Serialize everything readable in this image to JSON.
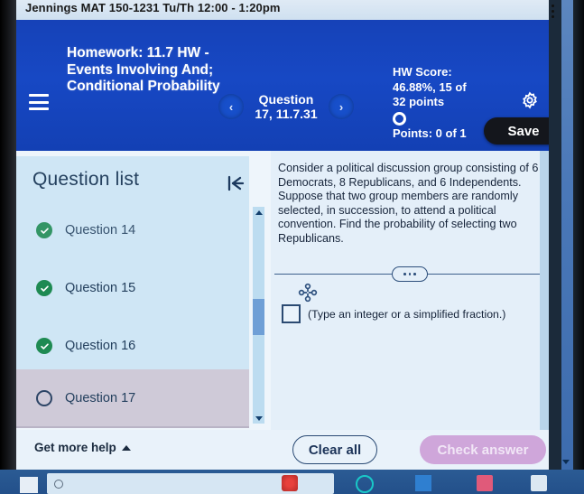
{
  "course_strip": {
    "title": "Jennings MAT 150-1231 Tu/Th 12:00 - 1:20pm",
    "kebab_icon": "more-vertical-icon"
  },
  "header": {
    "menu_icon": "hamburger-menu-icon",
    "homework_title": "Homework: 11.7 HW - Events Involving And; Conditional Probability",
    "prev_label": "‹",
    "next_label": "›",
    "question_nav_label": "Question 17, 11.7.31",
    "hw_score_label": "HW Score:",
    "hw_score_value": "46.88%, 15 of 32 points",
    "points_label": "Points: 0 of 1",
    "status_icon": "empty-circle-icon",
    "settings_icon": "gear-icon",
    "save_label": "Save",
    "accent_blue": "#1748c4",
    "save_bg": "#14161c"
  },
  "question_list": {
    "heading": "Question list",
    "collapse_icon": "collapse-panel-left-icon",
    "items": [
      {
        "label": "Question 14",
        "status": "complete"
      },
      {
        "label": "Question 15",
        "status": "complete"
      },
      {
        "label": "Question 16",
        "status": "complete"
      },
      {
        "label": "Question 17",
        "status": "current"
      }
    ],
    "scroll_up_icon": "scroll-up-arrow-icon",
    "scroll_down_icon": "scroll-down-arrow-icon",
    "complete_color": "#1e8a52",
    "selected_bg": "#cfcad8"
  },
  "question": {
    "text": "Consider a political discussion group consisting of 6 Democrats, 8 Republicans, and 6 Independents. Suppose that two group members are randomly selected, in succession, to attend a political convention.  Find the probability of selecting two Republicans.",
    "more_options_icon": "ellipsis-pill-icon",
    "move_handle_icon": "move-handle-icon",
    "answer_value": "",
    "answer_placeholder": "",
    "answer_note": "(Type an integer or a simplified fraction.)"
  },
  "actions": {
    "get_more_help_label": "Get more help",
    "get_more_help_icon": "caret-up-icon",
    "clear_all_label": "Clear all",
    "check_answer_label": "Check answer",
    "check_answer_bg": "#cfa6da"
  },
  "taskbar": {
    "start_icon": "windows-start-icon",
    "search_icon": "search-icon",
    "app_icons": [
      "red-app-icon",
      "teal-circle-icon",
      "blue-app-icon",
      "pink-app-icon",
      "white-app-icon"
    ]
  }
}
